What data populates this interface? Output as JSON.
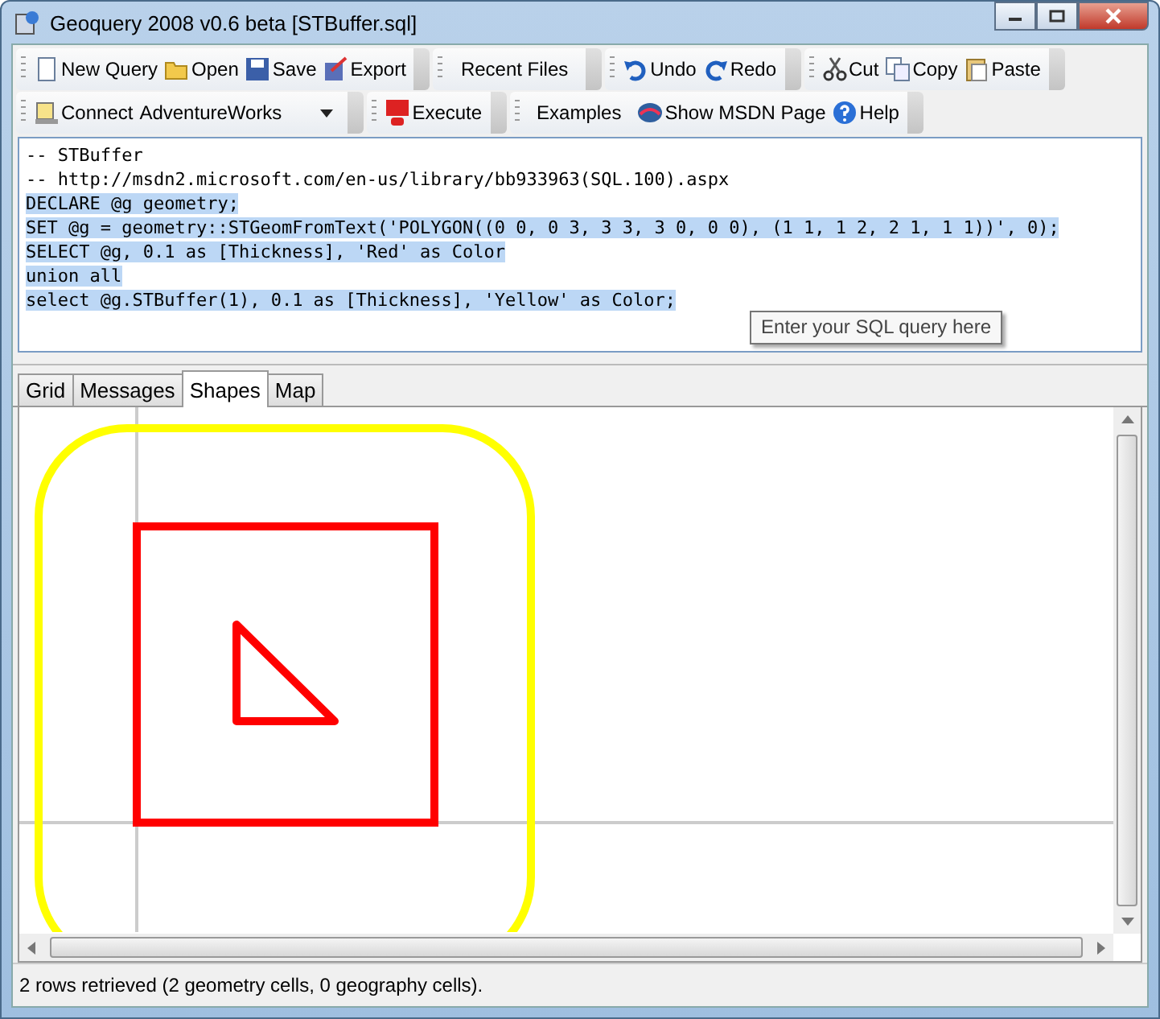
{
  "window": {
    "title": "Geoquery 2008 v0.6 beta [STBuffer.sql]"
  },
  "toolbars": [
    [
      [
        {
          "kind": "button",
          "label": "New Query"
        },
        {
          "kind": "button",
          "label": "Open"
        },
        {
          "kind": "button",
          "label": "Save"
        },
        {
          "kind": "button",
          "label": "Export"
        }
      ],
      [
        {
          "kind": "text",
          "label": "Recent Files"
        }
      ],
      [
        {
          "kind": "button",
          "label": "Undo"
        },
        {
          "kind": "button",
          "label": "Redo"
        }
      ],
      [
        {
          "kind": "button",
          "label": "Cut"
        },
        {
          "kind": "button",
          "label": "Copy"
        },
        {
          "kind": "button",
          "label": "Paste"
        }
      ]
    ],
    [
      [
        {
          "kind": "button",
          "label": "Connect"
        },
        {
          "kind": "combo",
          "label": "AdventureWorks"
        }
      ],
      [
        {
          "kind": "button",
          "label": "Execute"
        }
      ],
      [
        {
          "kind": "text",
          "label": "Examples"
        },
        {
          "kind": "button",
          "label": "Show MSDN Page"
        },
        {
          "kind": "button",
          "label": "Help"
        }
      ]
    ]
  ],
  "editor": {
    "lines": [
      {
        "text": "-- STBuffer",
        "selected": false
      },
      {
        "text": "-- http://msdn2.microsoft.com/en-us/library/bb933963(SQL.100).aspx",
        "selected": false
      },
      {
        "text": "DECLARE @g geometry;",
        "selected": true
      },
      {
        "text": "SET @g = geometry::STGeomFromText('POLYGON((0 0, 0 3, 3 3, 3 0, 0 0), (1 1, 1 2, 2 1, 1 1))', 0);",
        "selected": true
      },
      {
        "text": "SELECT @g, 0.1 as [Thickness], 'Red' as Color",
        "selected": true
      },
      {
        "text": "union all",
        "selected": true
      },
      {
        "text": "select @g.STBuffer(1), 0.1 as [Thickness], 'Yellow' as Color;",
        "selected": true
      }
    ],
    "tooltip": "Enter your SQL query here"
  },
  "tabs": [
    {
      "label": "Grid",
      "selected": false
    },
    {
      "label": "Messages",
      "selected": false
    },
    {
      "label": "Shapes",
      "selected": true
    },
    {
      "label": "Map",
      "selected": false
    }
  ],
  "shapes": [
    {
      "color": "#ffff00"
    },
    {
      "color": "#ff0000"
    }
  ],
  "status_bar": "2 rows retrieved (2 geometry cells, 0 geography cells)."
}
